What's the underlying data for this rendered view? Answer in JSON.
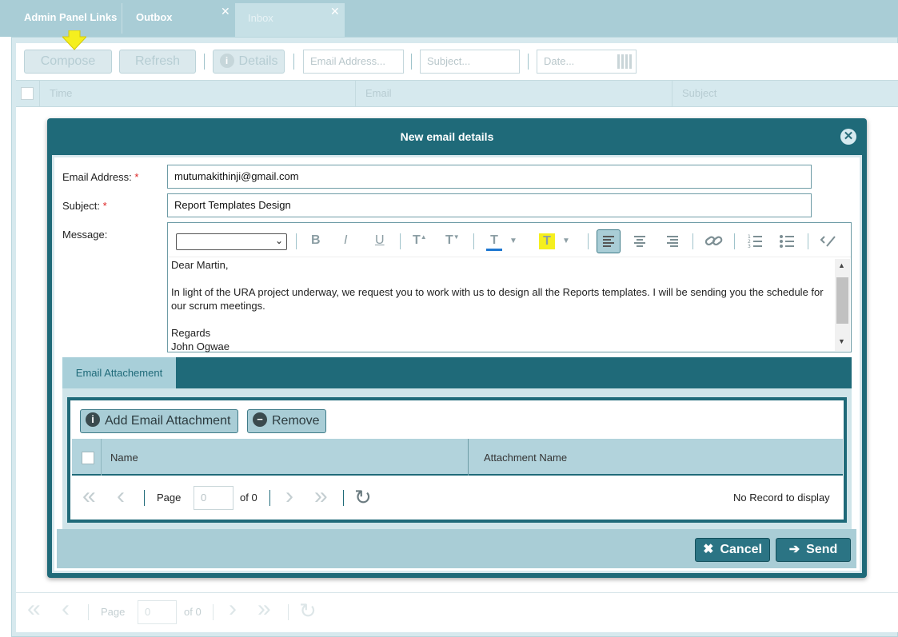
{
  "tabs": [
    {
      "label": "Admin Panel Links"
    },
    {
      "label": "Outbox"
    },
    {
      "label": "Inbox"
    }
  ],
  "toolbar": {
    "compose": "Compose",
    "refresh": "Refresh",
    "details": "Details",
    "email_placeholder": "Email Address...",
    "subject_placeholder": "Subject...",
    "date_placeholder": "Date..."
  },
  "grid": {
    "columns": [
      "Time",
      "Email",
      "Subject"
    ]
  },
  "footer": {
    "page_label": "Page",
    "page_value": "0",
    "of_label": "of 0"
  },
  "dialog": {
    "title": "New email details",
    "email_label": "Email Address:",
    "email_value": "mutumakithinji@gmail.com",
    "subject_label": "Subject:",
    "subject_value": "Report Templates Design",
    "message_label": "Message:",
    "message_lines": [
      "Dear Martin,",
      "",
      "In light of the URA project underway, we request you to work with us to design all the Reports templates. I will be sending you the schedule for our scrum meetings.",
      "",
      "Regards",
      "John Ogwae"
    ],
    "attachment_tab": "Email Attachement",
    "add_attachment": "Add Email Attachment",
    "remove": "Remove",
    "att_columns": [
      "Name",
      "Attachment Name"
    ],
    "att_page_label": "Page",
    "att_page_value": "0",
    "att_of_label": "of 0",
    "no_record": "No Record to display",
    "cancel": "Cancel",
    "send": "Send"
  },
  "colors": {
    "accent": "#1f6a79",
    "highlight_yellow": "#f5ef1e",
    "font_color_blue": "#1f78d1"
  }
}
